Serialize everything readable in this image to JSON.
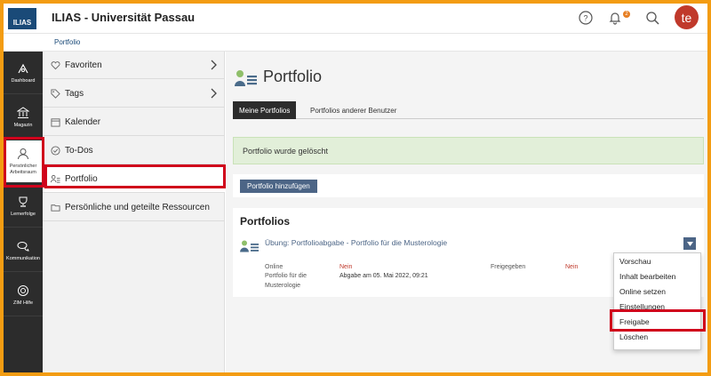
{
  "header": {
    "logo_text": "ILIAS",
    "title": "ILIAS - Universität Passau",
    "notification_count": "2",
    "avatar_initials": "te",
    "accent": "#c0392b"
  },
  "breadcrumb": {
    "item": "Portfolio"
  },
  "rail": [
    {
      "label": "Dashboard",
      "icon": "dashboard-icon"
    },
    {
      "label": "Magazin",
      "icon": "library-icon"
    },
    {
      "label": "Persönlicher Arbeitsraum",
      "icon": "person-icon"
    },
    {
      "label": "Lernerfolge",
      "icon": "trophy-icon"
    },
    {
      "label": "Kommunikation",
      "icon": "chat-icon"
    },
    {
      "label": "ZIM Hilfe",
      "icon": "help-icon"
    }
  ],
  "slate": [
    {
      "label": "Favoriten",
      "icon": "heart-icon"
    },
    {
      "label": "Tags",
      "icon": "tag-icon"
    },
    {
      "label": "Kalender",
      "icon": "calendar-icon"
    },
    {
      "label": "To-Dos",
      "icon": "check-circle-icon"
    },
    {
      "label": "Portfolio",
      "icon": "portfolio-icon"
    },
    {
      "label": "Persönliche und geteilte Ressourcen",
      "icon": "folder-icon"
    }
  ],
  "main": {
    "title": "Portfolio",
    "tabs": [
      "Meine Portfolios",
      "Portfolios anderer Benutzer"
    ],
    "success_message": "Portfolio wurde gelöscht",
    "add_button": "Portfolio hinzufügen",
    "panel_title": "Portfolios",
    "item": {
      "title": "Übung: Portfolioabgabe - Portfolio für die Musterologie",
      "prop_online_label": "Online",
      "prop_online_value": "Nein",
      "prop_shared_label": "Freigegeben",
      "prop_shared_value": "Nein",
      "prop_portfolio_label": "Portfolio für die Musterologie",
      "prop_portfolio_value": "Abgabe am 05. Mai 2022, 09:21"
    }
  },
  "dropdown": [
    "Vorschau",
    "Inhalt bearbeiten",
    "Online setzen",
    "Einstellungen",
    "Freigabe",
    "Löschen"
  ]
}
